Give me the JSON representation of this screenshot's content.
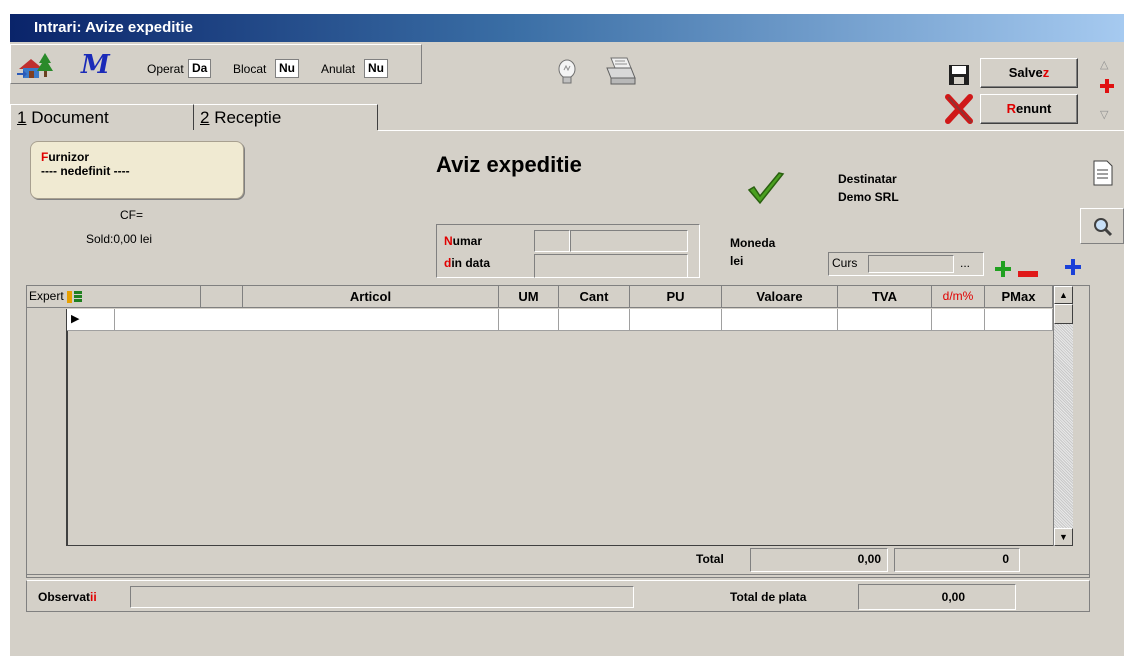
{
  "window": {
    "title": "Intrari: Avize expeditie"
  },
  "toolbar": {
    "operat_label": "Operat",
    "operat_value": "Da",
    "blocat_label": "Blocat",
    "blocat_value": "Nu",
    "anulat_label": "Anulat",
    "anulat_value": "Nu"
  },
  "actions": {
    "save_label_main": "Salve",
    "save_label_hot": "z",
    "cancel_label_hot": "R",
    "cancel_label_main": "enunt"
  },
  "tabs": [
    {
      "hot": "1",
      "label": " Document"
    },
    {
      "hot": "2",
      "label": " Receptie"
    }
  ],
  "furnizor": {
    "label_hot": "F",
    "label_main": "urnizor",
    "value": "---- nedefinit ----"
  },
  "cf": "CF=",
  "sold": "Sold:0,00 lei",
  "document_title": "Aviz expeditie",
  "destinatar": {
    "label": "Destinatar",
    "value": "Demo SRL"
  },
  "numar": {
    "hot": "N",
    "label": "umar"
  },
  "din_data": {
    "hot": "d",
    "label": "in data"
  },
  "moneda": {
    "label": "Moneda",
    "value": "lei"
  },
  "curs": {
    "label": "Curs",
    "dots": "..."
  },
  "grid": {
    "expert_label": "Expert",
    "columns": [
      "Articol",
      "UM",
      "Cant",
      "PU",
      "Valoare",
      "TVA",
      "d/m%",
      "PMax"
    ]
  },
  "totals": {
    "label": "Total",
    "value": "0,00",
    "count": "0"
  },
  "observatii": {
    "label_main": "Observat",
    "label_hot": "ii"
  },
  "total_plata": {
    "label": "Total de plata",
    "value": "0,00"
  },
  "colors": {
    "accent_red": "#e00000",
    "title_gradient_start": "#0a246a",
    "check_green": "#4aa020"
  }
}
